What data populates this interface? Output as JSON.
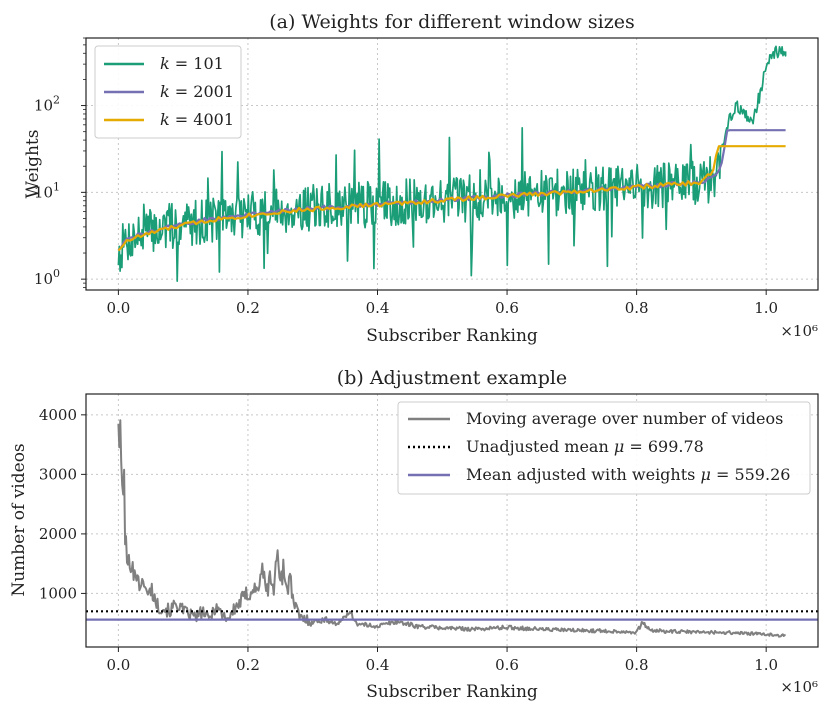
{
  "chart_data": [
    {
      "type": "line",
      "title": "(a) Weights for different window sizes",
      "xlabel": "Subscriber Ranking",
      "ylabel": "Weights",
      "x_multiplier": "×10⁶",
      "xlim": [
        -0.05,
        1.08
      ],
      "ylim": [
        0.75,
        600
      ],
      "yscale": "log",
      "grid": true,
      "legend_position": "top-left",
      "x_ticks": [
        {
          "value": 0.0,
          "label": "0.0"
        },
        {
          "value": 0.2,
          "label": "0.2"
        },
        {
          "value": 0.4,
          "label": "0.4"
        },
        {
          "value": 0.6,
          "label": "0.6"
        },
        {
          "value": 0.8,
          "label": "0.8"
        },
        {
          "value": 1.0,
          "label": "1.0"
        }
      ],
      "y_ticks": [
        {
          "value": 1,
          "base": "10",
          "exp": "0"
        },
        {
          "value": 10,
          "base": "10",
          "exp": "1"
        },
        {
          "value": 100,
          "base": "10",
          "exp": "2"
        }
      ],
      "series": [
        {
          "name_prefix": "k",
          "name_value": " = 101",
          "color": "#1b9e77",
          "noisy": true,
          "x": [
            0.0,
            0.01,
            0.02,
            0.05,
            0.1,
            0.15,
            0.2,
            0.25,
            0.3,
            0.35,
            0.4,
            0.45,
            0.5,
            0.55,
            0.6,
            0.65,
            0.7,
            0.75,
            0.8,
            0.85,
            0.9,
            0.92,
            0.93,
            0.94,
            0.95,
            0.96,
            0.97,
            0.98,
            0.99,
            1.0,
            1.01,
            1.03
          ],
          "y": [
            2.0,
            2.6,
            3.0,
            3.6,
            4.3,
            5.0,
            5.6,
            6.2,
            6.6,
            7.0,
            7.3,
            7.7,
            8.2,
            8.6,
            9.2,
            9.6,
            10.2,
            10.8,
            11.5,
            12.2,
            13.0,
            15.0,
            25.0,
            55.0,
            95.0,
            90.0,
            75.0,
            70.0,
            130.0,
            260.0,
            420.0,
            420.0
          ]
        },
        {
          "name_prefix": "k",
          "name_value": " = 2001",
          "color": "#7570b3",
          "noisy": false,
          "x": [
            0.0,
            0.01,
            0.02,
            0.05,
            0.1,
            0.15,
            0.2,
            0.25,
            0.3,
            0.35,
            0.4,
            0.45,
            0.5,
            0.55,
            0.6,
            0.65,
            0.7,
            0.75,
            0.8,
            0.85,
            0.9,
            0.92,
            0.93,
            0.935,
            0.94,
            1.03
          ],
          "y": [
            2.2,
            2.7,
            3.0,
            3.5,
            4.3,
            5.0,
            5.5,
            6.1,
            6.5,
            6.9,
            7.3,
            7.7,
            8.2,
            8.7,
            9.2,
            9.7,
            10.3,
            10.9,
            11.6,
            12.3,
            13.2,
            15.0,
            19.0,
            30.0,
            52.0,
            52.0
          ]
        },
        {
          "name_prefix": "k",
          "name_value": " = 4001",
          "color": "#e6ab02",
          "noisy": false,
          "x": [
            0.0,
            0.01,
            0.02,
            0.05,
            0.1,
            0.15,
            0.2,
            0.25,
            0.3,
            0.35,
            0.4,
            0.45,
            0.5,
            0.55,
            0.6,
            0.65,
            0.7,
            0.75,
            0.8,
            0.85,
            0.9,
            0.92,
            0.925,
            1.03
          ],
          "y": [
            2.2,
            2.6,
            2.9,
            3.4,
            4.2,
            4.9,
            5.4,
            6.0,
            6.4,
            6.8,
            7.2,
            7.6,
            8.1,
            8.6,
            9.1,
            9.6,
            10.2,
            10.8,
            11.5,
            12.2,
            13.0,
            18.0,
            34.0,
            34.0
          ]
        }
      ]
    },
    {
      "type": "line",
      "title": "(b) Adjustment example",
      "xlabel": "Subscriber Ranking",
      "ylabel": "Number of videos",
      "x_multiplier": "×10⁶",
      "xlim": [
        -0.05,
        1.08
      ],
      "ylim": [
        100,
        4350
      ],
      "yscale": "linear",
      "grid": true,
      "legend_position": "top-right",
      "x_ticks": [
        {
          "value": 0.0,
          "label": "0.0"
        },
        {
          "value": 0.2,
          "label": "0.2"
        },
        {
          "value": 0.4,
          "label": "0.4"
        },
        {
          "value": 0.6,
          "label": "0.6"
        },
        {
          "value": 0.8,
          "label": "0.8"
        },
        {
          "value": 1.0,
          "label": "1.0"
        }
      ],
      "y_ticks": [
        {
          "value": 1000,
          "label": "1000"
        },
        {
          "value": 2000,
          "label": "2000"
        },
        {
          "value": 3000,
          "label": "3000"
        },
        {
          "value": 4000,
          "label": "4000"
        }
      ],
      "series": [
        {
          "name": "Moving average over number of videos",
          "color": "#808080",
          "style": "solid",
          "x": [
            0.0,
            0.002,
            0.004,
            0.006,
            0.008,
            0.01,
            0.012,
            0.015,
            0.02,
            0.025,
            0.03,
            0.035,
            0.04,
            0.045,
            0.05,
            0.06,
            0.07,
            0.08,
            0.09,
            0.1,
            0.11,
            0.12,
            0.13,
            0.14,
            0.15,
            0.16,
            0.17,
            0.18,
            0.19,
            0.2,
            0.21,
            0.215,
            0.22,
            0.225,
            0.23,
            0.235,
            0.24,
            0.245,
            0.25,
            0.255,
            0.26,
            0.265,
            0.27,
            0.28,
            0.3,
            0.32,
            0.34,
            0.355,
            0.37,
            0.4,
            0.43,
            0.46,
            0.5,
            0.55,
            0.6,
            0.65,
            0.7,
            0.75,
            0.8,
            0.81,
            0.82,
            0.85,
            0.9,
            0.95,
            1.0,
            1.03
          ],
          "y": [
            4150,
            3300,
            3500,
            2600,
            3200,
            2100,
            1700,
            1400,
            1650,
            1250,
            1400,
            1000,
            1300,
            900,
            1100,
            800,
            750,
            700,
            850,
            700,
            650,
            600,
            700,
            560,
            800,
            650,
            580,
            750,
            880,
            1000,
            1100,
            1000,
            1450,
            1200,
            1050,
            1300,
            1050,
            1650,
            1300,
            1400,
            1100,
            1250,
            850,
            600,
            520,
            560,
            480,
            700,
            480,
            450,
            530,
            450,
            420,
            400,
            430,
            400,
            380,
            370,
            350,
            520,
            380,
            360,
            350,
            340,
            310,
            290
          ]
        },
        {
          "name_prefix": "Unadjusted mean ",
          "name_var": "μ",
          "name_value": " = 699.78",
          "color": "#000000",
          "style": "dotted",
          "value": 699.78
        },
        {
          "name_prefix": "Mean adjusted with weights ",
          "name_var": "μ",
          "name_value": " = 559.26",
          "color": "#7570b3",
          "style": "solid",
          "value": 559.26
        }
      ]
    }
  ]
}
